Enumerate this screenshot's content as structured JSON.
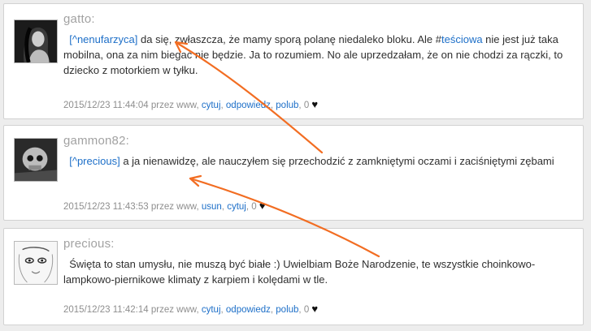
{
  "comments": [
    {
      "username": "gatto:",
      "mention": "[^nenufarzyca]",
      "text_before_hashtag": " da się, zwłaszcza, że mamy sporą polanę niedaleko bloku. Ale #",
      "hashtag": "teściowa",
      "text_line1_end": " nie",
      "text_rest": "jest już taka mobilna, ona za nim biegać nie będzie. Ja to rozumiem. No ale uprzedzałam, że on nie chodzi za rączki, to dziecko z motorkiem w tyłku.",
      "meta_prefix": "2015/12/23 11:44:04 przez www, ",
      "actions": [
        "cytuj",
        "odpowiedz",
        "polub"
      ],
      "likes": "0",
      "heart": "♥"
    },
    {
      "username": "gammon82:",
      "mention": "[^precious]",
      "text": " a ja nienawidzę, ale nauczyłem się przechodzić z zamkniętymi oczami i zaciśniętymi zębami",
      "meta_prefix": "2015/12/23 11:43:53 przez www, ",
      "actions": [
        "usun",
        "cytuj"
      ],
      "likes": "0",
      "heart": "♥"
    },
    {
      "username": "precious:",
      "text": "Święta to stan umysłu, nie muszą być białe :) Uwielbiam Boże Narodzenie, te wszystkie choinkowo-lampkowo-piernikowe klimaty z karpiem i kolędami w tle.",
      "meta_prefix": "2015/12/23 11:42:14 przez www, ",
      "actions": [
        "cytuj",
        "odpowiedz",
        "polub"
      ],
      "likes": "0",
      "heart": "♥"
    }
  ],
  "colors": {
    "link": "#1d6fc8",
    "arrow": "#f26d22",
    "username": "#a2a2a2",
    "meta": "#8e8e8e"
  }
}
